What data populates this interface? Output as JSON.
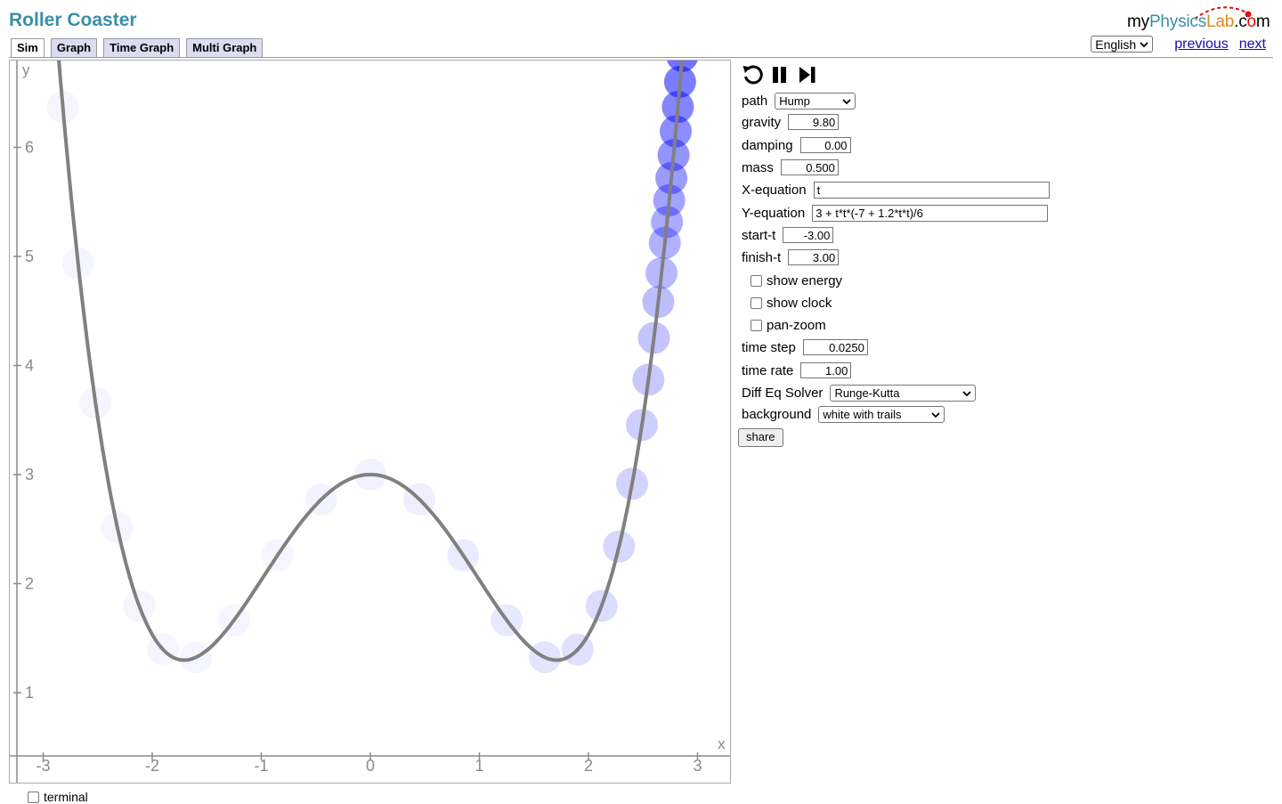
{
  "app": {
    "title": "Roller Coaster",
    "logo_my": "my",
    "logo_physics": "Physics",
    "logo_lab": "Lab",
    "logo_dot": ".c",
    "logo_com": "m"
  },
  "tabs": [
    {
      "label": "Sim",
      "active": true
    },
    {
      "label": "Graph",
      "active": false
    },
    {
      "label": "Time Graph",
      "active": false
    },
    {
      "label": "Multi Graph",
      "active": false
    }
  ],
  "nav": {
    "language": "English",
    "previous": "previous",
    "next": "next"
  },
  "controls": {
    "path_label": "path",
    "path_value": "Hump",
    "gravity_label": "gravity",
    "gravity_value": "9.80",
    "damping_label": "damping",
    "damping_value": "0.00",
    "mass_label": "mass",
    "mass_value": "0.500",
    "xeq_label": "X-equation",
    "xeq_value": "t",
    "yeq_label": "Y-equation",
    "yeq_value": "3 + t*t*(-7 + 1.2*t*t)/6",
    "start_label": "start-t",
    "start_value": "-3.00",
    "finish_label": "finish-t",
    "finish_value": "3.00",
    "show_energy": "show energy",
    "show_clock": "show clock",
    "pan_zoom": "pan-zoom",
    "timestep_label": "time step",
    "timestep_value": "0.0250",
    "timerate_label": "time rate",
    "timerate_value": "1.00",
    "solver_label": "Diff Eq Solver",
    "solver_value": "Runge-Kutta",
    "background_label": "background",
    "background_value": "white with trails",
    "share_label": "share"
  },
  "sim": {
    "x_axis_label": "x",
    "y_axis_label": "y",
    "x_ticks": [
      "-3",
      "-2",
      "-1",
      "0",
      "1",
      "2",
      "3"
    ],
    "y_ticks": [
      "1",
      "2",
      "3",
      "4",
      "5",
      "6"
    ],
    "ball_t": 2.88,
    "trail_t": [
      2.86,
      2.84,
      2.82,
      2.8,
      2.78,
      2.76,
      2.74,
      2.72,
      2.7,
      2.67,
      2.64,
      2.6,
      2.55,
      2.49,
      2.4,
      2.28,
      2.12,
      1.9,
      1.6,
      1.25,
      0.85,
      0.45,
      0.0,
      -0.45,
      -0.85,
      -1.25,
      -1.6,
      -1.9,
      -2.12,
      -2.32,
      -2.52,
      -2.68,
      -2.82,
      -2.93
    ],
    "track_color": "#808080",
    "ball_color": "#0000ff"
  },
  "bottom": {
    "terminal": "terminal"
  }
}
